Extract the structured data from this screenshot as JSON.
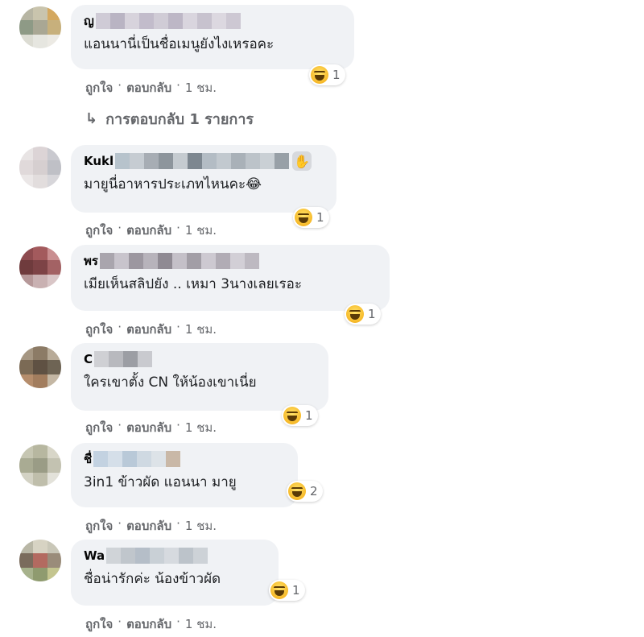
{
  "comments": [
    {
      "name": "ญ",
      "text": "แอนนานี่เป็นชื่อเมนูยังไงเหรอคะ",
      "reaction_count": "1",
      "like": "ถูกใจ",
      "reply": "ตอบกลับ",
      "time": "1 ชม."
    },
    {
      "name": "Kukl",
      "text": "มายูนี่อาหารประเภทไหนคะ😂",
      "reaction_count": "1",
      "like": "ถูกใจ",
      "reply": "ตอบกลับ",
      "time": "1 ชม."
    },
    {
      "name": "พร",
      "text": "เมียเห็นสลิปยัง .. เหมา 3นางเลยเรอะ",
      "reaction_count": "1",
      "like": "ถูกใจ",
      "reply": "ตอบกลับ",
      "time": "1 ชม."
    },
    {
      "name": "C",
      "text": "ใครเขาตั้ง CN ให้น้องเขาเนี่ย",
      "reaction_count": "1",
      "like": "ถูกใจ",
      "reply": "ตอบกลับ",
      "time": "1 ชม."
    },
    {
      "name": "ชื่",
      "text": "3in1 ข้าวผัด แอนนา มายู",
      "reaction_count": "2",
      "like": "ถูกใจ",
      "reply": "ตอบกลับ",
      "time": "1 ชม."
    },
    {
      "name": "Wa",
      "text": "ชื่อน่ารักค่ะ น้องข้าวผัด",
      "reaction_count": "1",
      "like": "ถูกใจ",
      "reply": "ตอบกลับ",
      "time": "1 ชม."
    }
  ],
  "replies_link": "การตอบกลับ 1 รายการ",
  "dot": "·",
  "reply_arrow": "↳",
  "icons": {
    "reaction": "haha-emoji-icon",
    "wave": "waving-hand-icon",
    "reply_arrow": "reply-arrow-icon"
  },
  "colors": {
    "bubble": "#f0f2f5",
    "meta_text": "#65676b",
    "text": "#050505"
  }
}
